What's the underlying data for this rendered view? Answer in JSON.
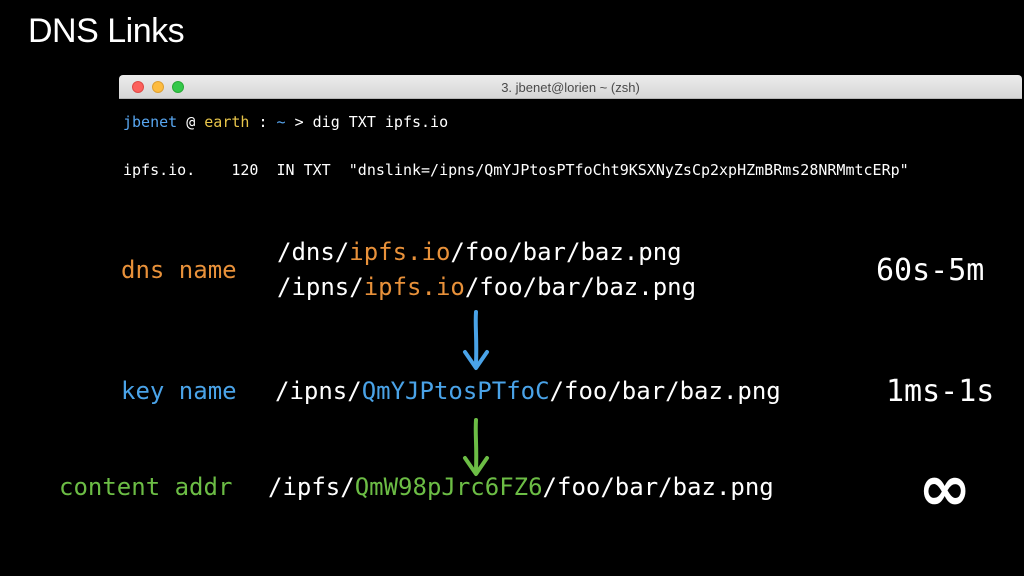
{
  "slide": {
    "title": "DNS Links"
  },
  "terminal": {
    "window_title": "3. jbenet@lorien ~ (zsh)",
    "prompt": {
      "user": "jbenet",
      "at": " @ ",
      "host": "earth",
      "sep": " : ",
      "dir": "~",
      "arrow": " > ",
      "command": "dig TXT ipfs.io"
    },
    "output_line": "ipfs.io.    120  IN TXT  \"dnslink=/ipns/QmYJPtosPTfoCht9KSXNyZsCp2xpHZmBRms28NRMmtcERp\""
  },
  "dns": {
    "label": "dns name",
    "path1_prefix": "/dns/",
    "path1_highlight": "ipfs.io",
    "path1_suffix": "/foo/bar/baz.png",
    "path2_prefix": "/ipns/",
    "path2_highlight": "ipfs.io",
    "path2_suffix": "/foo/bar/baz.png",
    "timing": "60s-5m"
  },
  "key": {
    "label": "key name",
    "path_prefix": "/ipns/",
    "path_highlight": "QmYJPtosPTfoC",
    "path_suffix": "/foo/bar/baz.png",
    "timing": "1ms-1s"
  },
  "content": {
    "label": "content addr",
    "path_prefix": "/ipfs/",
    "path_highlight": "QmW98pJrc6FZ6",
    "path_suffix": "/foo/bar/baz.png",
    "timing": "∞"
  },
  "colors": {
    "dns": "#e8913a",
    "key": "#4aa3e8",
    "content": "#6cbd45"
  }
}
